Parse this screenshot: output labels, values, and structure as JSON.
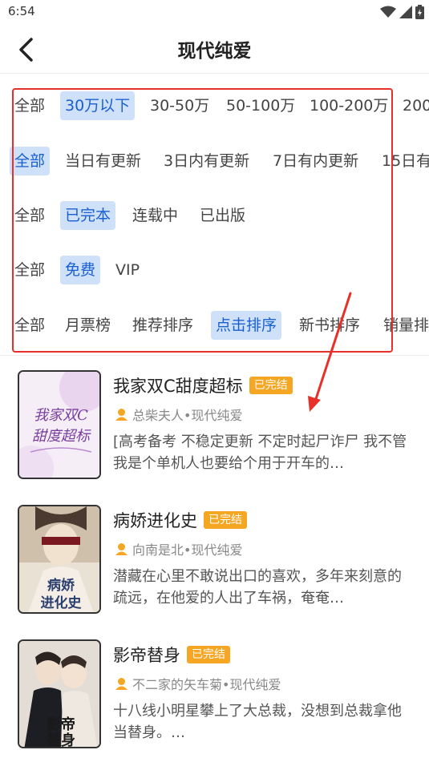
{
  "status_bar": {
    "time": "6:54"
  },
  "header": {
    "title": "现代纯爱"
  },
  "filters": {
    "word_count": [
      "全部",
      "30万以下",
      "30-50万",
      "50-100万",
      "100-200万",
      "200"
    ],
    "update": [
      "全部",
      "当日有更新",
      "3日内有更新",
      "7日有内更新",
      "15日有"
    ],
    "status": [
      "全部",
      "已完本",
      "连载中",
      "已出版"
    ],
    "price": [
      "全部",
      "免费",
      "VIP"
    ],
    "sort": [
      "全部",
      "月票榜",
      "推荐排序",
      "点击排序",
      "新书排序",
      "销量排"
    ]
  },
  "books": [
    {
      "title": "我家双C甜度超标",
      "badge": "已完结",
      "meta": "总柴夫人•现代纯爱",
      "desc": "[高考备考 不稳定更新 不定时起尸诈尸 我不管我是个单机人也要给个用于开车的…",
      "cover_text": "我家双C甜度超标"
    },
    {
      "title": "病娇进化史",
      "badge": "已完结",
      "meta": "向南是北•现代纯爱",
      "desc": "潜藏在心里不敢说出口的喜欢，多年来刻意的疏远，在他爱的人出了车祸，奄奄…",
      "cover_text": "病娇进化史"
    },
    {
      "title": "影帝替身",
      "badge": "已完结",
      "meta": "不二家的矢车菊•现代纯爱",
      "desc": "十八线小明星攀上了大总裁，没想到总裁拿他当替身。…",
      "cover_text": "影帝替身"
    }
  ],
  "colors": {
    "accent": "#1a5fd1",
    "chip_active_bg": "#cfe1f8",
    "badge": "#f5a623",
    "annotation": "#e8302a"
  }
}
